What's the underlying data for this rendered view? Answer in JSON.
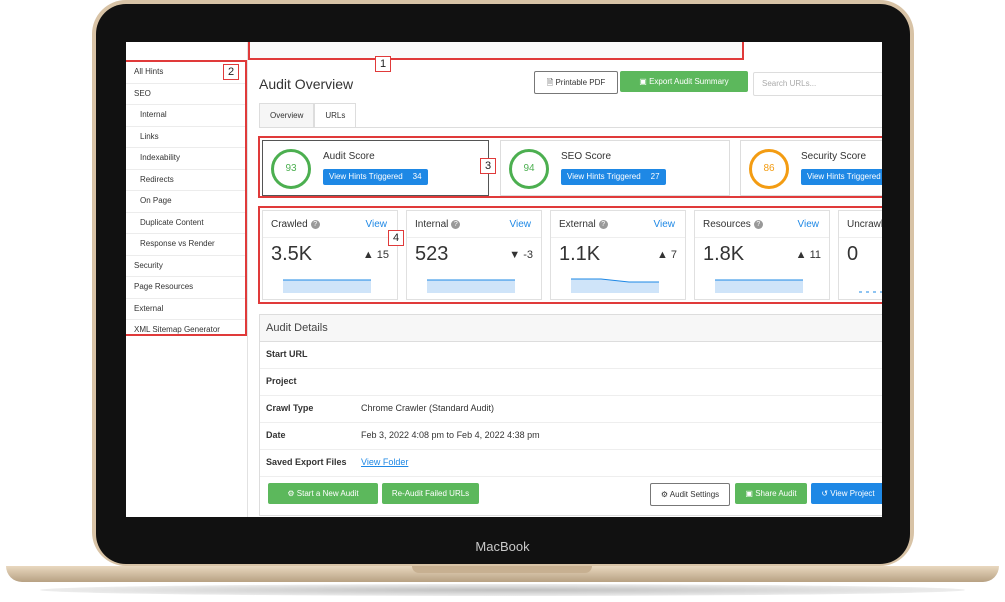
{
  "device": {
    "brand_label": "MacBook"
  },
  "sidebar": {
    "items": [
      {
        "label": "All Hints",
        "sub": false
      },
      {
        "label": "SEO",
        "sub": false
      },
      {
        "label": "Internal",
        "sub": true
      },
      {
        "label": "Links",
        "sub": true
      },
      {
        "label": "Indexability",
        "sub": true
      },
      {
        "label": "Redirects",
        "sub": true
      },
      {
        "label": "On Page",
        "sub": true
      },
      {
        "label": "Duplicate Content",
        "sub": true
      },
      {
        "label": "Response vs Render",
        "sub": true
      },
      {
        "label": "Security",
        "sub": false
      },
      {
        "label": "Page Resources",
        "sub": false
      },
      {
        "label": "External",
        "sub": false
      },
      {
        "label": "XML Sitemap Generator",
        "sub": false
      }
    ]
  },
  "callouts": {
    "c1": "1",
    "c2": "2",
    "c3": "3",
    "c4": "4"
  },
  "header": {
    "title": "Audit Overview",
    "printable_pdf": "Printable PDF",
    "export_summary": "Export Audit Summary",
    "search_placeholder": "Search URLs..."
  },
  "tabs": {
    "overview": "Overview",
    "urls": "URLs"
  },
  "scores": {
    "hint_button": "View Hints Triggered",
    "cards": [
      {
        "value": "93",
        "title": "Audit Score",
        "count": "34"
      },
      {
        "value": "94",
        "title": "SEO Score",
        "count": "27"
      },
      {
        "value": "86",
        "title": "Security Score",
        "count": ""
      }
    ]
  },
  "metrics": {
    "view_label": "View",
    "cards": [
      {
        "label": "Crawled",
        "value": "3.5K",
        "delta": "▲ 15"
      },
      {
        "label": "Internal",
        "value": "523",
        "delta": "▼ -3"
      },
      {
        "label": "External",
        "value": "1.1K",
        "delta": "▲ 7"
      },
      {
        "label": "Resources",
        "value": "1.8K",
        "delta": "▲ 11"
      },
      {
        "label": "Uncrawled",
        "value": "0",
        "delta": ""
      }
    ]
  },
  "details": {
    "heading": "Audit Details",
    "rows": [
      {
        "key": "Start URL",
        "value": ""
      },
      {
        "key": "Project",
        "value": ""
      },
      {
        "key": "Crawl Type",
        "value": "Chrome Crawler (Standard Audit)"
      },
      {
        "key": "Date",
        "value": "Feb 3, 2022 4:08 pm to Feb 4, 2022 4:38 pm"
      },
      {
        "key": "Saved Export Files",
        "value": "View Folder"
      }
    ]
  },
  "footer": {
    "start_new": "Start a New Audit",
    "re_audit": "Re-Audit Failed URLs",
    "audit_settings": "Audit Settings",
    "share_audit": "Share Audit",
    "view_project": "View Project"
  },
  "colors": {
    "accent_green": "#5cb85c",
    "accent_blue": "#1e88e5",
    "highlight_red": "#e03a3a",
    "score_orange": "#f39c12"
  }
}
